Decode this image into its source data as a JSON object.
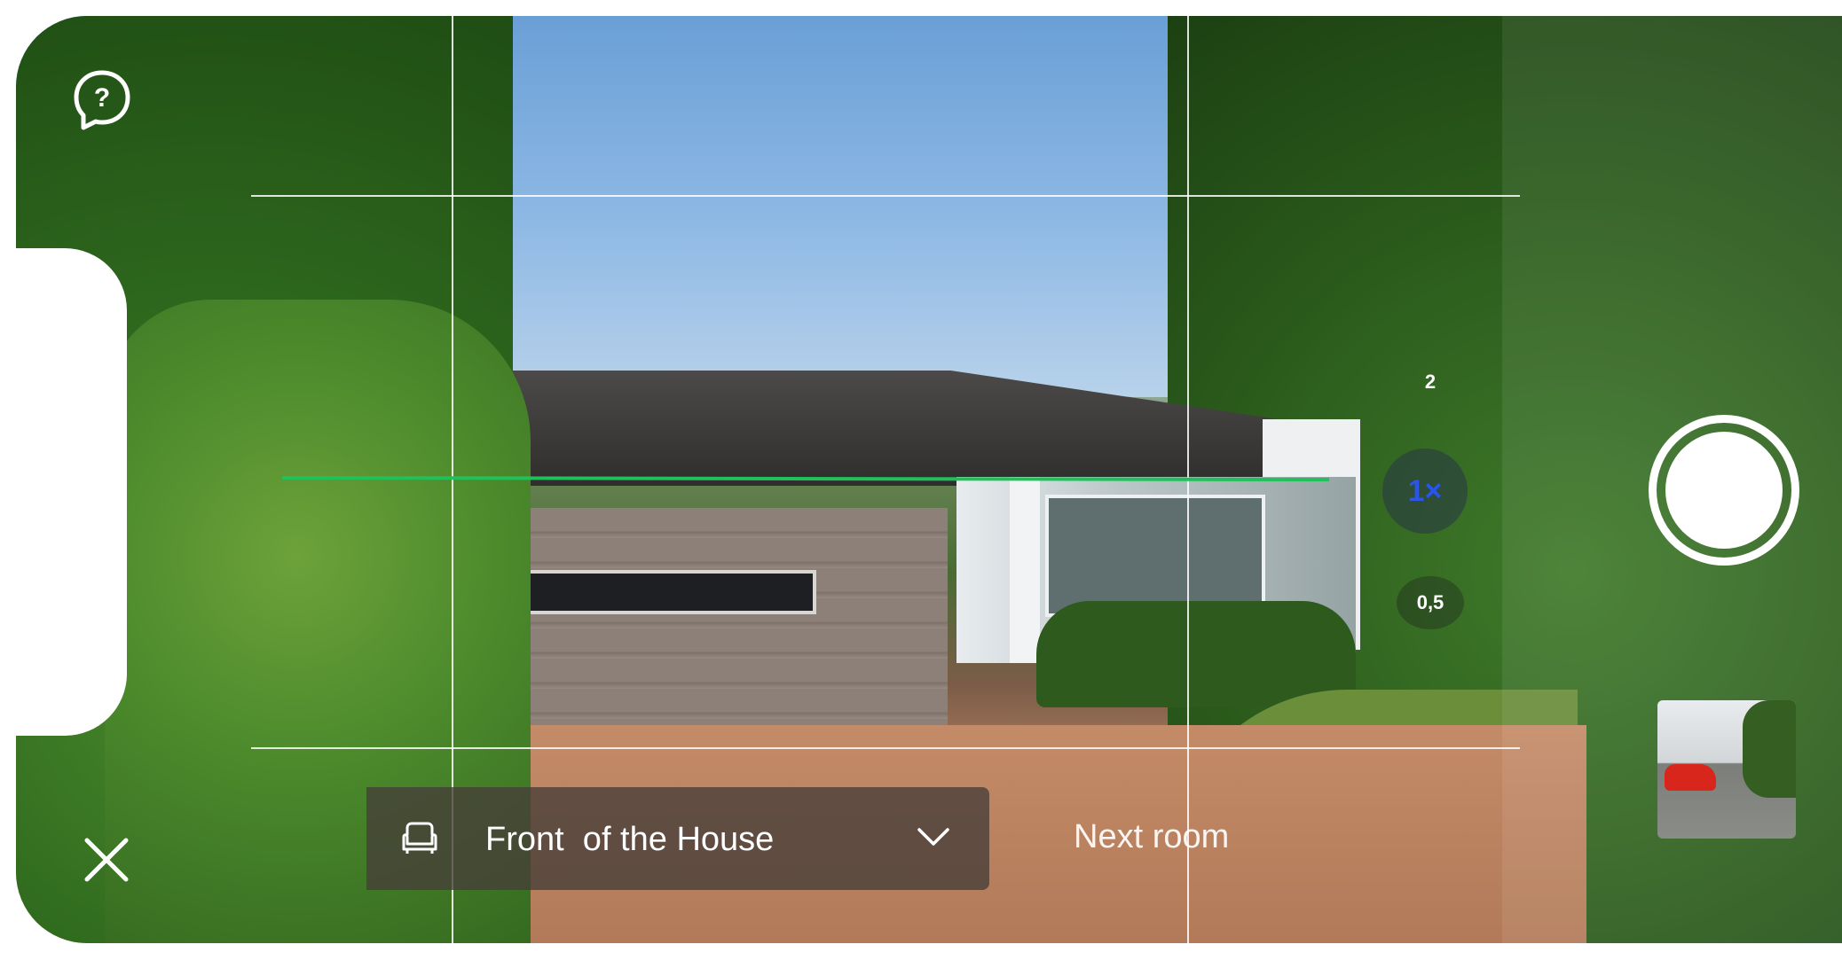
{
  "app": {
    "title": ""
  },
  "help": {
    "icon": "help-icon"
  },
  "close": {
    "icon": "close-icon"
  },
  "room_selector": {
    "icon": "armchair-icon",
    "label": "Front  of the House",
    "chevron": "chevron-down-icon"
  },
  "next_room": {
    "label": "Next room"
  },
  "zoom": {
    "options": [
      {
        "label": "2"
      },
      {
        "label": "1×",
        "selected": true
      },
      {
        "label": "0,5"
      }
    ],
    "selected_color": "#2a55e6"
  },
  "level_indicator": {
    "color": "#20c05a",
    "state": "level"
  },
  "shutter": {
    "icon": "shutter-button"
  },
  "last_capture": {
    "icon": "photo-thumbnail"
  }
}
